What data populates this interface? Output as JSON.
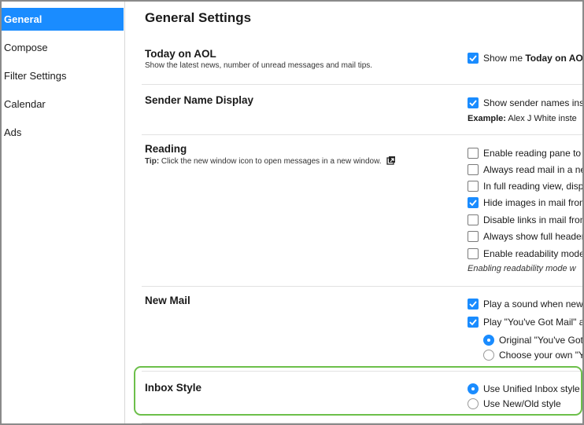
{
  "sidebar": {
    "items": [
      {
        "label": "General",
        "active": true
      },
      {
        "label": "Compose",
        "active": false
      },
      {
        "label": "Filter Settings",
        "active": false
      },
      {
        "label": "Calendar",
        "active": false
      },
      {
        "label": "Ads",
        "active": false
      }
    ]
  },
  "main": {
    "title": "General Settings",
    "sections": {
      "today": {
        "title": "Today on AOL",
        "desc": "Show the latest news, number of unread messages and mail tips.",
        "option_prefix": "Show me ",
        "option_bold": "Today on AOL",
        "option_checked": true
      },
      "sender": {
        "title": "Sender Name Display",
        "option": "Show sender names inste",
        "option_checked": true,
        "example_label": "Example:",
        "example_text": " Alex J White inste"
      },
      "reading": {
        "title": "Reading",
        "tip_label": "Tip:",
        "tip_text": " Click the new window icon to open messages in a new window.",
        "tip_icon": "new-window-icon",
        "options": [
          {
            "label": "Enable reading pane to p",
            "checked": false
          },
          {
            "label": "Always read mail in a ne",
            "checked": false
          },
          {
            "label": "In full reading view, displ",
            "checked": false
          },
          {
            "label": "Hide images in mail from",
            "checked": true
          },
          {
            "label": "Disable links in mail from",
            "checked": false
          },
          {
            "label": "Always show full headers",
            "checked": false
          },
          {
            "label": "Enable readability mode",
            "checked": false
          }
        ],
        "note": "Enabling readability mode w"
      },
      "newmail": {
        "title": "New Mail",
        "options": [
          {
            "label": "Play a sound when new",
            "checked": true
          },
          {
            "label": "Play \"You've Got Mail\" al",
            "checked": true
          }
        ],
        "radios": [
          {
            "label": "Original \"You've Got",
            "selected": true
          },
          {
            "label": "Choose your own \"Y",
            "selected": false
          }
        ]
      },
      "inbox": {
        "title": "Inbox Style",
        "radios": [
          {
            "label": "Use Unified Inbox style",
            "selected": true
          },
          {
            "label": "Use New/Old style",
            "selected": false
          }
        ]
      }
    }
  },
  "colors": {
    "accent": "#1a8cff",
    "highlight": "#6cbf4a"
  }
}
